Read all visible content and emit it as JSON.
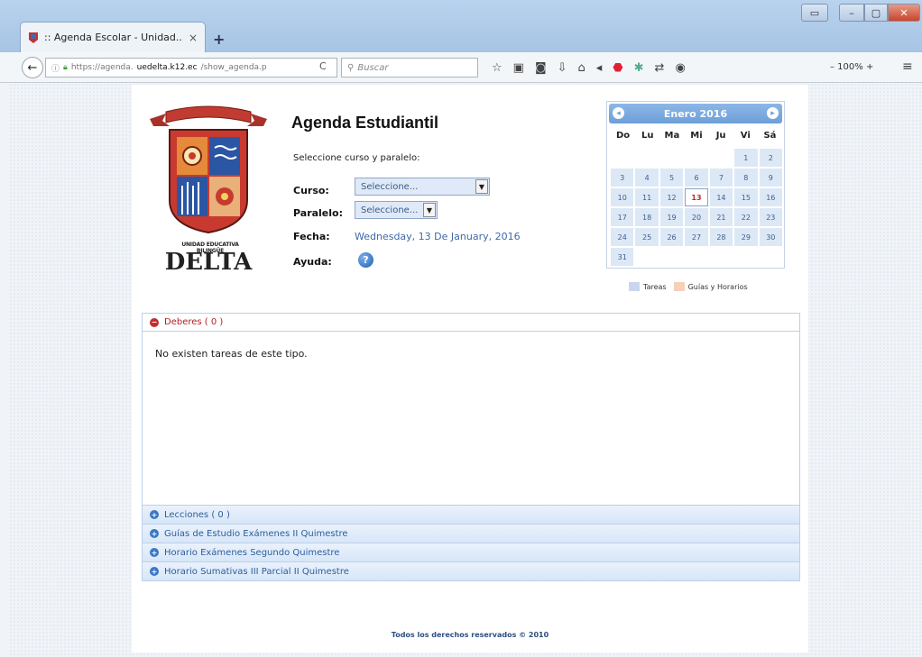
{
  "browser": {
    "tab_title": ":: Agenda Escolar - Unidad...",
    "tab_close": "×",
    "new_tab": "+",
    "url_prefix": "https://agenda.",
    "url_domain": "uedelta.k12.ec",
    "url_path": "/show_agenda.p",
    "search_placeholder": "Buscar",
    "zoom": "– 100% +"
  },
  "header": {
    "title": "Agenda Estudiantil",
    "prompt": "Seleccione curso y paralelo:"
  },
  "logo": {
    "subtitle": "UNIDAD EDUCATIVA BILINGÜE",
    "name": "DELTA"
  },
  "form": {
    "curso_label": "Curso:",
    "curso_value": "Seleccione...",
    "paralelo_label": "Paralelo:",
    "paralelo_value": "Seleccione...",
    "fecha_label": "Fecha:",
    "fecha_value": "Wednesday, 13 De January, 2016",
    "ayuda_label": "Ayuda:",
    "ayuda_icon": "?"
  },
  "calendar": {
    "title": "Enero 2016",
    "day_names": [
      "Do",
      "Lu",
      "Ma",
      "Mi",
      "Ju",
      "Vi",
      "Sá"
    ],
    "leading_blanks": 5,
    "days": [
      "1",
      "2",
      "3",
      "4",
      "5",
      "6",
      "7",
      "8",
      "9",
      "10",
      "11",
      "12",
      "13",
      "14",
      "15",
      "16",
      "17",
      "18",
      "19",
      "20",
      "21",
      "22",
      "23",
      "24",
      "25",
      "26",
      "27",
      "28",
      "29",
      "30",
      "31"
    ],
    "today": "13",
    "colors": {
      "cell": "#dde8f6",
      "today_text": "#c82424"
    }
  },
  "legend": {
    "tareas": "Tareas",
    "guias": "Guías y Horarios",
    "tareas_color": "#c9d6ee",
    "guias_color": "#f6d0b8"
  },
  "accordion": {
    "deberes": "Deberes ( 0 )",
    "deberes_empty": "No existen tareas de este tipo.",
    "lecciones": "Lecciones ( 0 )",
    "guias": "Guías de Estudio Exámenes II Quimestre",
    "horario_examenes": "Horario Exámenes Segundo Quimestre",
    "horario_sumativas": "Horario Sumativas III Parcial II Quimestre"
  },
  "footer": {
    "text": "Todos los derechos reservados © 2010"
  }
}
